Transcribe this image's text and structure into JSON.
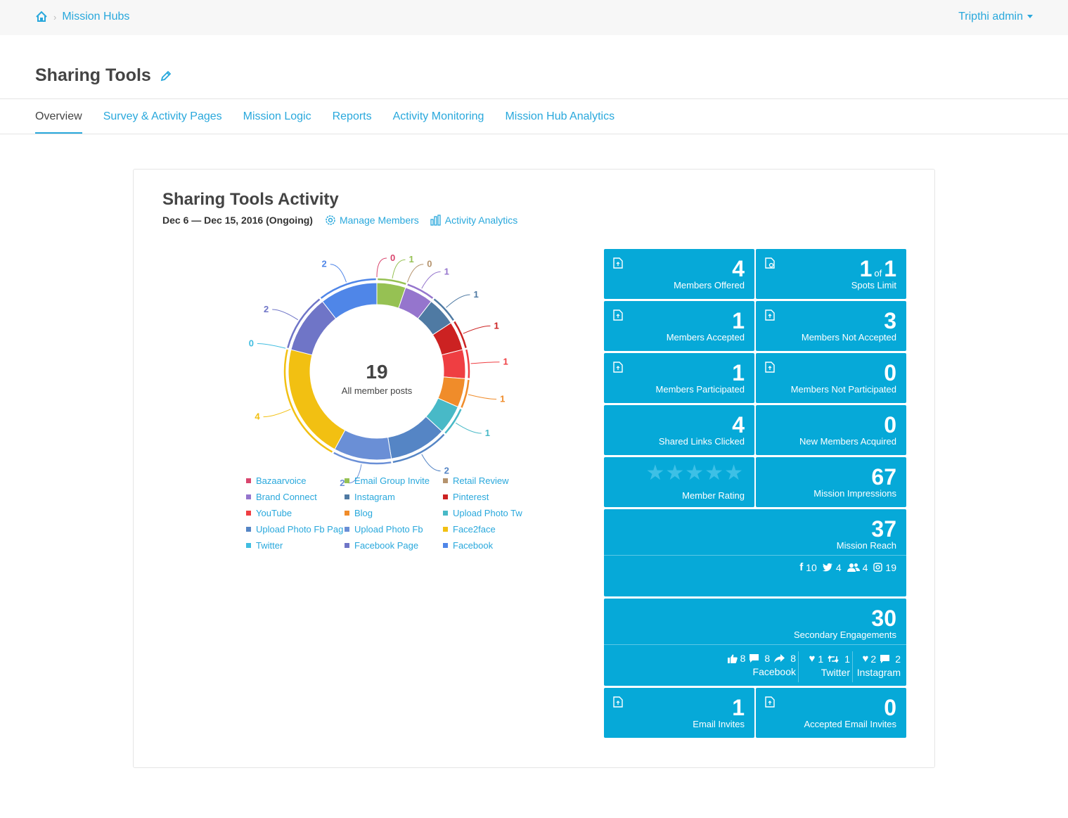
{
  "breadcrumb": {
    "home_icon": "home-icon",
    "current": "Mission Hubs"
  },
  "user": {
    "name": "Tripthi admin"
  },
  "page": {
    "title": "Sharing Tools"
  },
  "tabs": [
    {
      "label": "Overview",
      "active": true
    },
    {
      "label": "Survey & Activity Pages"
    },
    {
      "label": "Mission Logic"
    },
    {
      "label": "Reports"
    },
    {
      "label": "Activity Monitoring"
    },
    {
      "label": "Mission Hub Analytics"
    }
  ],
  "activity": {
    "title": "Sharing Tools Activity",
    "date_range": "Dec 6 — Dec 15, 2016 (Ongoing)",
    "manage_members": "Manage Members",
    "activity_analytics": "Activity Analytics"
  },
  "chart_data": {
    "type": "pie",
    "center_value": "19",
    "center_label": "All member posts",
    "slices": [
      {
        "name": "Bazaarvoice",
        "value": 0,
        "color": "#d9466e"
      },
      {
        "name": "Email Group Invite",
        "value": 1,
        "color": "#96c153"
      },
      {
        "name": "Retail Review",
        "value": 0,
        "color": "#b5936d"
      },
      {
        "name": "Brand Connect",
        "value": 1,
        "color": "#9575cd"
      },
      {
        "name": "Instagram",
        "value": 1,
        "color": "#4f7aa3"
      },
      {
        "name": "Pinterest",
        "value": 1,
        "color": "#cc2222"
      },
      {
        "name": "YouTube",
        "value": 1,
        "color": "#ef3e42"
      },
      {
        "name": "Blog",
        "value": 1,
        "color": "#f08c2a"
      },
      {
        "name": "Upload Photo Tw",
        "value": 1,
        "color": "#48b9c7"
      },
      {
        "name": "Upload Photo Fb Page",
        "value": 2,
        "color": "#5585c5"
      },
      {
        "name": "Upload Photo Fb",
        "value": 2,
        "color": "#6a8fd6"
      },
      {
        "name": "Face2face",
        "value": 4,
        "color": "#f2c012"
      },
      {
        "name": "Twitter",
        "value": 0,
        "color": "#40bde0"
      },
      {
        "name": "Facebook Page",
        "value": 2,
        "color": "#6f75c7"
      },
      {
        "name": "Facebook",
        "value": 2,
        "color": "#4f86e8"
      }
    ],
    "legend_labels": [
      "Bazaarvoice",
      "Email Group Invite",
      "Retail Review",
      "Brand Connect",
      "Instagram",
      "Pinterest",
      "YouTube",
      "Blog",
      "Upload Photo Tw",
      "Upload Photo Fb Pag",
      "Upload Photo Fb",
      "Face2face",
      "Twitter",
      "Facebook Page",
      "Facebook"
    ]
  },
  "tiles": {
    "members_offered": {
      "value": "4",
      "label": "Members Offered"
    },
    "spots_limit": {
      "value": "1",
      "of": "of",
      "total": "1",
      "label": "Spots Limit"
    },
    "members_accepted": {
      "value": "1",
      "label": "Members Accepted"
    },
    "members_not_accepted": {
      "value": "3",
      "label": "Members Not Accepted"
    },
    "members_participated": {
      "value": "1",
      "label": "Members Participated"
    },
    "members_not_participated": {
      "value": "0",
      "label": "Members Not Participated"
    },
    "shared_links_clicked": {
      "value": "4",
      "label": "Shared Links Clicked"
    },
    "new_members_acquired": {
      "value": "0",
      "label": "New Members Acquired"
    },
    "member_rating": {
      "label": "Member Rating",
      "stars": 0,
      "max": 5
    },
    "mission_impressions": {
      "value": "67",
      "label": "Mission Impressions"
    },
    "mission_reach": {
      "value": "37",
      "label": "Mission Reach",
      "facebook": "10",
      "twitter": "4",
      "face2face": "4",
      "instagram": "19"
    },
    "secondary_engagements": {
      "value": "30",
      "label": "Secondary Engagements",
      "facebook": {
        "likes": "8",
        "comments": "8",
        "shares": "8",
        "name": "Facebook"
      },
      "twitter": {
        "likes": "1",
        "retweets": "1",
        "name": "Twitter"
      },
      "instagram": {
        "likes": "2",
        "comments": "2",
        "name": "Instagram"
      }
    },
    "email_invites": {
      "value": "1",
      "label": "Email Invites"
    },
    "accepted_email_invites": {
      "value": "0",
      "label": "Accepted Email Invites"
    }
  }
}
